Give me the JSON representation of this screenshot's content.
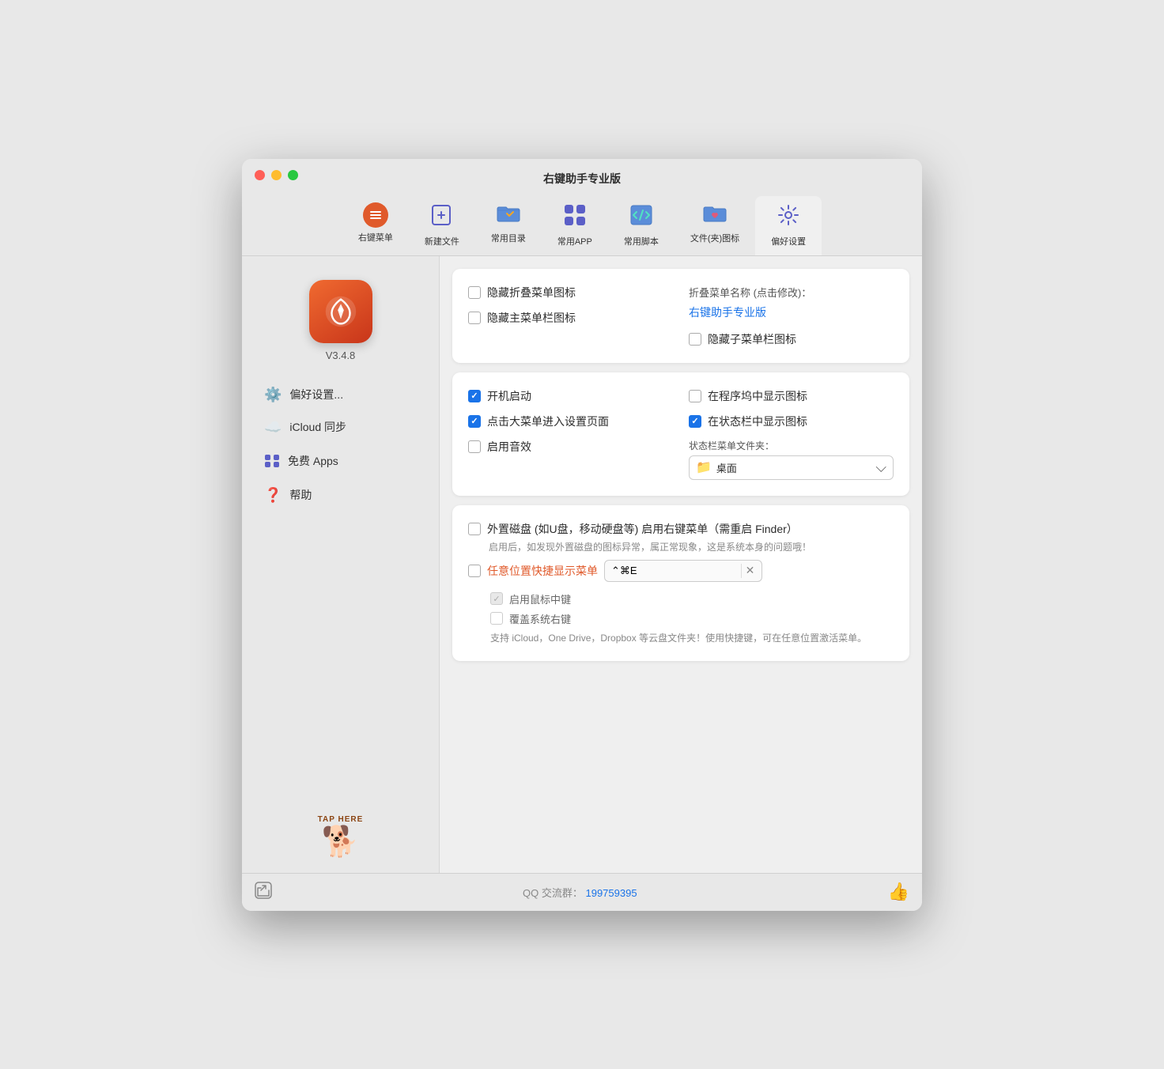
{
  "window": {
    "title": "右键助手专业版"
  },
  "toolbar": {
    "items": [
      {
        "id": "right-click-menu",
        "label": "右键菜单",
        "icon": "menu"
      },
      {
        "id": "new-file",
        "label": "新建文件",
        "icon": "new-file"
      },
      {
        "id": "common-dir",
        "label": "常用目录",
        "icon": "folder-star"
      },
      {
        "id": "common-app",
        "label": "常用APP",
        "icon": "app-store"
      },
      {
        "id": "common-script",
        "label": "常用脚本",
        "icon": "code"
      },
      {
        "id": "file-icon",
        "label": "文件(夹)图标",
        "icon": "heart-folder"
      },
      {
        "id": "settings",
        "label": "偏好设置",
        "icon": "gear",
        "active": true
      }
    ]
  },
  "sidebar": {
    "app_version": "V3.4.8",
    "menu_items": [
      {
        "id": "preferences",
        "label": "偏好设置...",
        "icon": "⚙️"
      },
      {
        "id": "icloud",
        "label": "iCloud 同步",
        "icon": "☁️"
      },
      {
        "id": "free-apps",
        "label": "免费 Apps",
        "icon": "🅰"
      },
      {
        "id": "help",
        "label": "帮助",
        "icon": "❓"
      }
    ],
    "tap_here_label": "TAP HERE"
  },
  "card1": {
    "hide_fold_icon_label": "隐藏折叠菜单图标",
    "hide_mainbar_icon_label": "隐藏主菜单栏图标",
    "fold_name_prefix": "折叠菜单名称 (点击修改)：",
    "fold_name_value": "右键助手专业版",
    "hide_submenu_icon_label": "隐藏子菜单栏图标"
  },
  "card2": {
    "auto_launch_label": "开机启动",
    "show_in_dock_label": "在程序坞中显示图标",
    "click_menu_to_settings_label": "点击大菜单进入设置页面",
    "show_in_statusbar_label": "在状态栏中显示图标",
    "enable_sound_label": "启用音效",
    "status_folder_label": "状态栏菜单文件夹：",
    "status_folder_value": "桌面",
    "auto_launch_checked": true,
    "click_menu_checked": true,
    "show_statusbar_checked": true,
    "show_dock_checked": false,
    "enable_sound_checked": false
  },
  "card3": {
    "external_disk_label": "外置磁盘 (如U盘，移动硬盘等) 启用右键菜单（需重启 Finder）",
    "external_disk_desc": "启用后，如发现外置磁盘的图标异常，属正常现象，这是系统本身的问题哦！",
    "quick_menu_label": "任意位置快捷显示菜单",
    "hotkey_value": "⌃⌘E",
    "enable_middle_click_label": "启用鼠标中键",
    "override_right_click_label": "覆盖系统右键",
    "desc_text": "支持 iCloud，One Drive，Dropbox 等云盘文件夹！使用快捷键，可在任意位置激活菜单。"
  },
  "footer": {
    "share_icon": "↗",
    "qq_label": "QQ 交流群：",
    "qq_number": "199759395",
    "like_icon": "👍"
  }
}
